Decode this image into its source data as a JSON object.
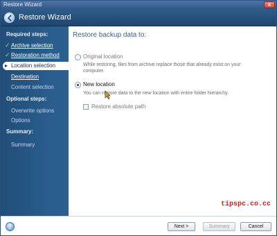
{
  "window": {
    "title": "Restore Wizard",
    "close_glyph": "x"
  },
  "header": {
    "title": "Restore Wizard",
    "back_icon": "back-arrow-icon"
  },
  "sidebar": {
    "sections": [
      {
        "label": "Required steps:"
      },
      {
        "label": "Optional steps:"
      },
      {
        "label": "Summary:"
      }
    ],
    "items": [
      {
        "label": "Archive selection",
        "state": "done"
      },
      {
        "label": "Restoration method",
        "state": "done"
      },
      {
        "label": "Location selection",
        "state": "active"
      },
      {
        "label": "Destination",
        "state": "link"
      },
      {
        "label": "Content selection",
        "state": "sub"
      },
      {
        "label": "Overwrite options",
        "state": "sub"
      },
      {
        "label": "Options",
        "state": "sub"
      },
      {
        "label": "Summary",
        "state": "sub"
      }
    ],
    "active_marker": "▸"
  },
  "main": {
    "title": "Restore backup data to:",
    "options": [
      {
        "label": "Original location",
        "selected": false,
        "enabled": false,
        "description": "While restoring, files from archive replace those that already exist on your computer."
      },
      {
        "label": "New location",
        "selected": true,
        "enabled": true,
        "description": "You can restore data to the new location with entire folder hierarchy."
      }
    ],
    "checkbox": {
      "label": "Restore absolute path",
      "checked": false,
      "enabled": false
    },
    "watermark": "tipspc.co.cc"
  },
  "footer": {
    "help_label": "?",
    "next_label": "Next >",
    "summary_label": "Summary",
    "cancel_label": "Cancel",
    "next_underline": "N",
    "summary_underline": "S",
    "cancel_underline": "C"
  },
  "colors": {
    "sidebar": "#1f4e79",
    "accent": "#3a5f8c",
    "watermark": "#e8191c"
  }
}
